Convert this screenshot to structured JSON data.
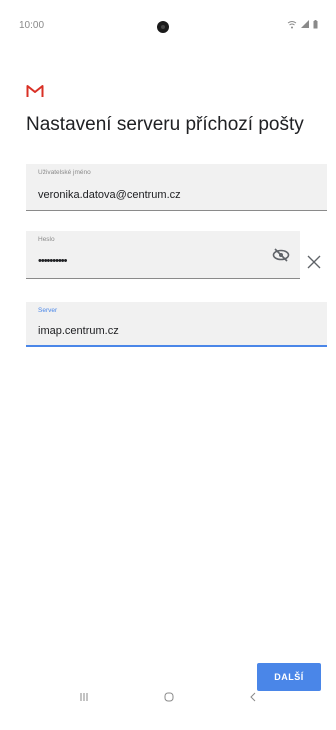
{
  "status_bar": {
    "time": "10:00",
    "icons": [
      "wifi-icon",
      "signal-icon",
      "battery-icon"
    ]
  },
  "app": {
    "logo": "gmail-icon",
    "accent": "#4a86e8"
  },
  "title": "Nastavení serveru příchozí pošty",
  "form": {
    "username": {
      "label": "Uživatelské jméno",
      "value": "veronika.datova@centrum.cz"
    },
    "password": {
      "label": "Heslo",
      "value": "••••••••••"
    },
    "server": {
      "label": "Server",
      "value": "imap.centrum.cz"
    }
  },
  "actions": {
    "next_label": "DALŠÍ"
  },
  "nav": [
    "recents-icon",
    "home-icon",
    "back-icon"
  ]
}
